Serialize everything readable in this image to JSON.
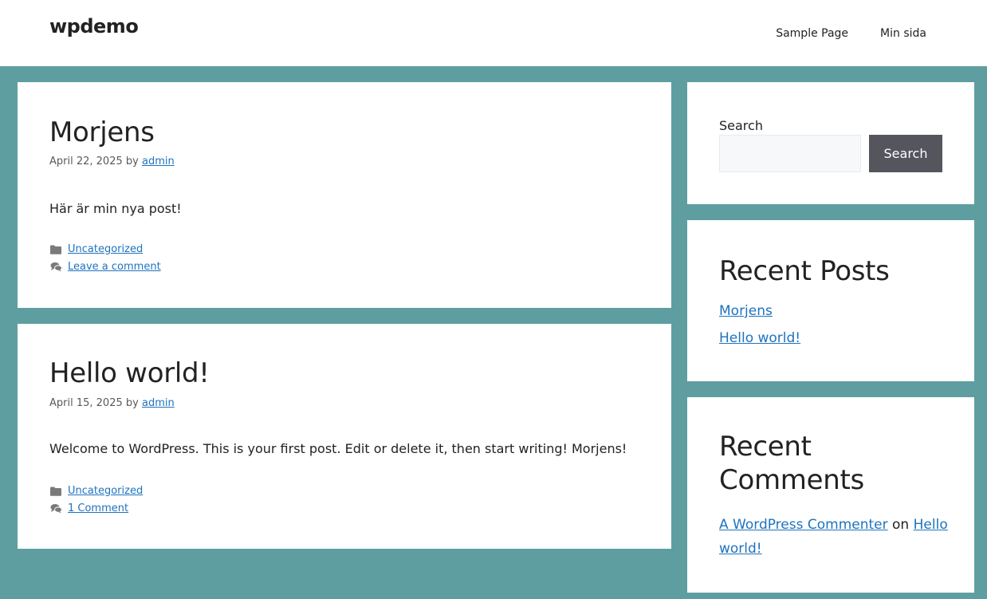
{
  "header": {
    "site_title": "wpdemo",
    "nav": [
      "Sample Page",
      "Min sida"
    ]
  },
  "posts": [
    {
      "title": "Morjens",
      "date": "April 22, 2025",
      "by": "by",
      "author": "admin",
      "excerpt": "Här är min nya post!",
      "category": "Uncategorized",
      "comments": "Leave a comment"
    },
    {
      "title": "Hello world!",
      "date": "April 15, 2025",
      "by": "by",
      "author": "admin",
      "excerpt": "Welcome to WordPress. This is your first post. Edit or delete it, then start writing! Morjens!",
      "category": "Uncategorized",
      "comments": "1 Comment"
    }
  ],
  "sidebar": {
    "search": {
      "label": "Search",
      "value": "",
      "button": "Search"
    },
    "recent_posts": {
      "title": "Recent Posts",
      "items": [
        "Morjens",
        "Hello world!"
      ]
    },
    "recent_comments": {
      "title": "Recent Comments",
      "commenter": "A WordPress Commenter",
      "on": "on",
      "post": "Hello world!"
    }
  },
  "colors": {
    "page_bg": "#5f9ea0",
    "link": "#1e73be",
    "button": "#55555e"
  },
  "icons": {
    "category": "folder-icon",
    "comments": "comments-icon"
  }
}
